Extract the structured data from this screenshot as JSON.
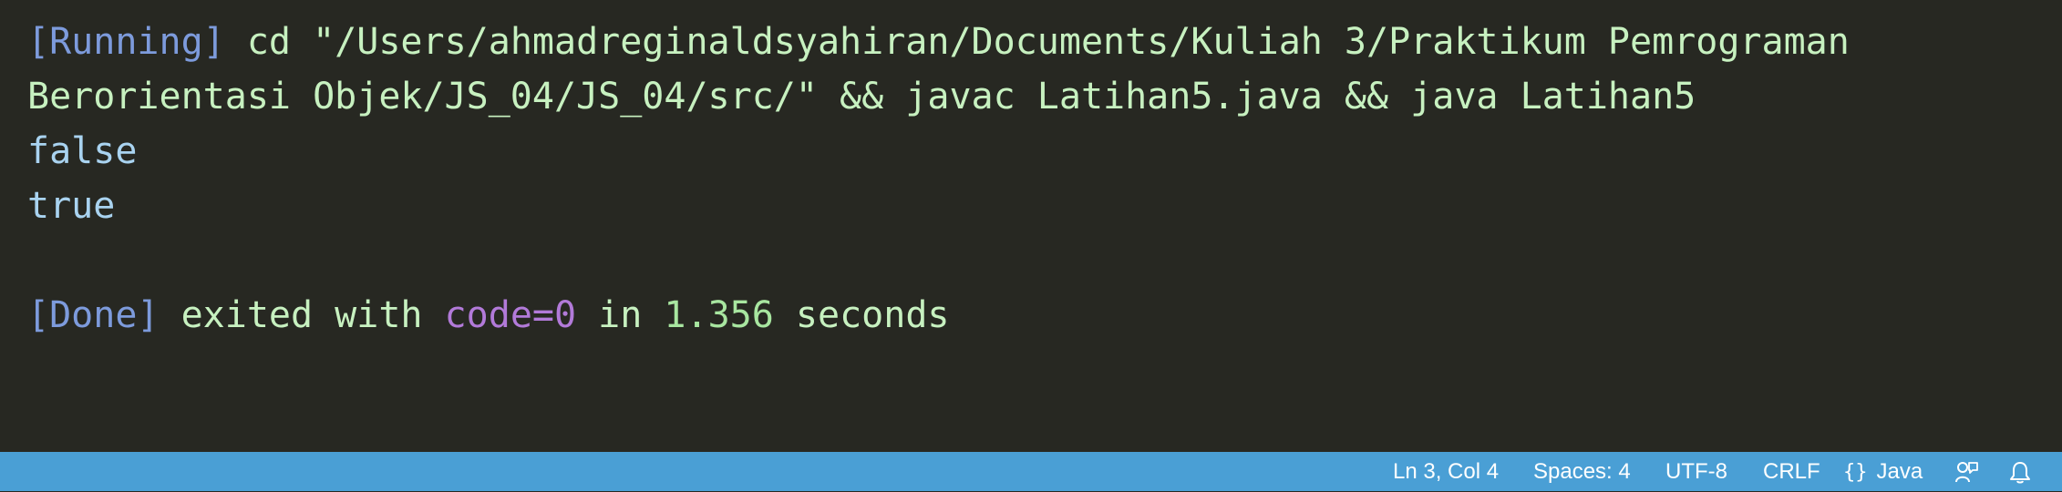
{
  "output": {
    "line1": {
      "tag": "[Running]",
      "command": " cd \"/Users/ahmadreginaldsyahiran/Documents/Kuliah 3/Praktikum Pemrograman"
    },
    "line2": {
      "command": "Berorientasi Objek/JS_04/JS_04/src/\" && javac Latihan5.java && java Latihan5"
    },
    "line3": "false",
    "line4": "true",
    "done": {
      "tag": "[Done]",
      "text1": " exited with ",
      "code": "code=0",
      "text2": " in ",
      "duration": "1.356",
      "text3": " seconds"
    }
  },
  "statusbar": {
    "cursor_position": "Ln 3, Col 4",
    "indentation": "Spaces: 4",
    "encoding": "UTF-8",
    "line_ending": "CRLF",
    "language_icon": "{}",
    "language": "Java",
    "feedback_icon": "feedback-icon",
    "notifications_icon": "bell-icon"
  },
  "colors": {
    "background": "#272822",
    "statusbar": "#4a9fd5",
    "output_text": "#c7f1c0",
    "tag": "#7d9bdc",
    "value": "#a9d3f0",
    "code": "#b27ad9"
  }
}
